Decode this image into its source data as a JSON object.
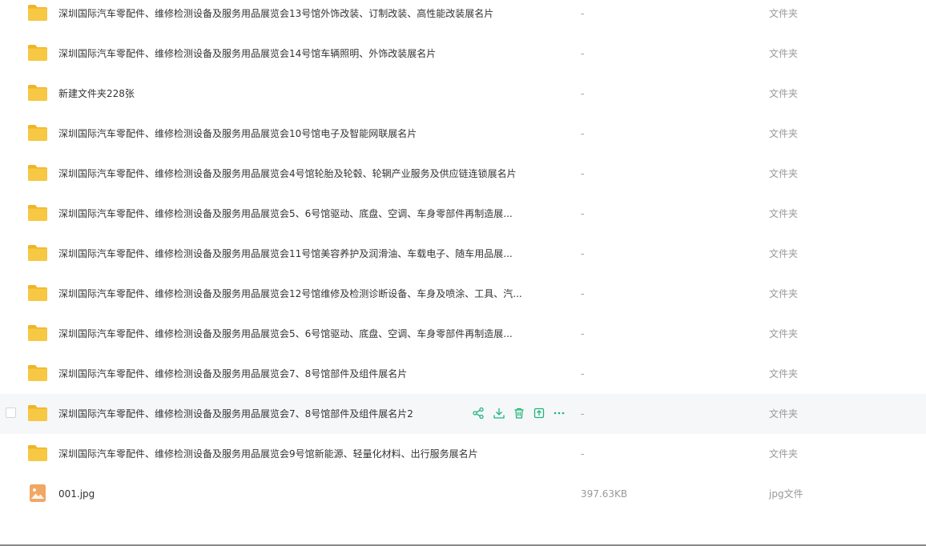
{
  "colors": {
    "folder": "#f7c844",
    "folder_tab": "#f1b427",
    "image_icon": "#f2a765",
    "accent": "#1fb57a",
    "text": "#333333",
    "muted": "#999999"
  },
  "files": [
    {
      "name": "深圳国际汽车零配件、维修检测设备及服务用品展览会13号馆外饰改装、订制改装、高性能改装展名片",
      "size": "-",
      "type": "文件夹",
      "icon": "folder-icon"
    },
    {
      "name": "深圳国际汽车零配件、维修检测设备及服务用品展览会14号馆车辆照明、外饰改装展名片",
      "size": "-",
      "type": "文件夹",
      "icon": "folder-icon"
    },
    {
      "name": "新建文件夹228张",
      "size": "-",
      "type": "文件夹",
      "icon": "folder-icon"
    },
    {
      "name": "深圳国际汽车零配件、维修检测设备及服务用品展览会10号馆电子及智能网联展名片",
      "size": "-",
      "type": "文件夹",
      "icon": "folder-icon"
    },
    {
      "name": "深圳国际汽车零配件、维修检测设备及服务用品展览会4号馆轮胎及轮毂、轮辋产业服务及供应链连锁展名片",
      "size": "-",
      "type": "文件夹",
      "icon": "folder-icon"
    },
    {
      "name": "深圳国际汽车零配件、维修检测设备及服务用品展览会5、6号馆驱动、底盘、空调、车身零部件再制造展...",
      "size": "-",
      "type": "文件夹",
      "icon": "folder-icon"
    },
    {
      "name": "深圳国际汽车零配件、维修检测设备及服务用品展览会11号馆美容养护及润滑油、车载电子、随车用品展...",
      "size": "-",
      "type": "文件夹",
      "icon": "folder-icon"
    },
    {
      "name": "深圳国际汽车零配件、维修检测设备及服务用品展览会12号馆维修及检测诊断设备、车身及喷涂、工具、汽...",
      "size": "-",
      "type": "文件夹",
      "icon": "folder-icon"
    },
    {
      "name": "深圳国际汽车零配件、维修检测设备及服务用品展览会5、6号馆驱动、底盘、空调、车身零部件再制造展...",
      "size": "-",
      "type": "文件夹",
      "icon": "folder-icon"
    },
    {
      "name": "深圳国际汽车零配件、维修检测设备及服务用品展览会7、8号馆部件及组件展名片",
      "size": "-",
      "type": "文件夹",
      "icon": "folder-icon"
    },
    {
      "name": "深圳国际汽车零配件、维修检测设备及服务用品展览会7、8号馆部件及组件展名片2",
      "size": "-",
      "type": "文件夹",
      "icon": "folder-icon",
      "hovered": true
    },
    {
      "name": "深圳国际汽车零配件、维修检测设备及服务用品展览会9号馆新能源、轻量化材料、出行服务展名片",
      "size": "-",
      "type": "文件夹",
      "icon": "folder-icon"
    },
    {
      "name": "001.jpg",
      "size": "397.63KB",
      "type": "jpg文件",
      "icon": "image-file-icon"
    }
  ],
  "row_actions": [
    {
      "icon": "share-icon"
    },
    {
      "icon": "download-icon"
    },
    {
      "icon": "delete-icon"
    },
    {
      "icon": "move-icon"
    },
    {
      "icon": "more-icon"
    }
  ]
}
